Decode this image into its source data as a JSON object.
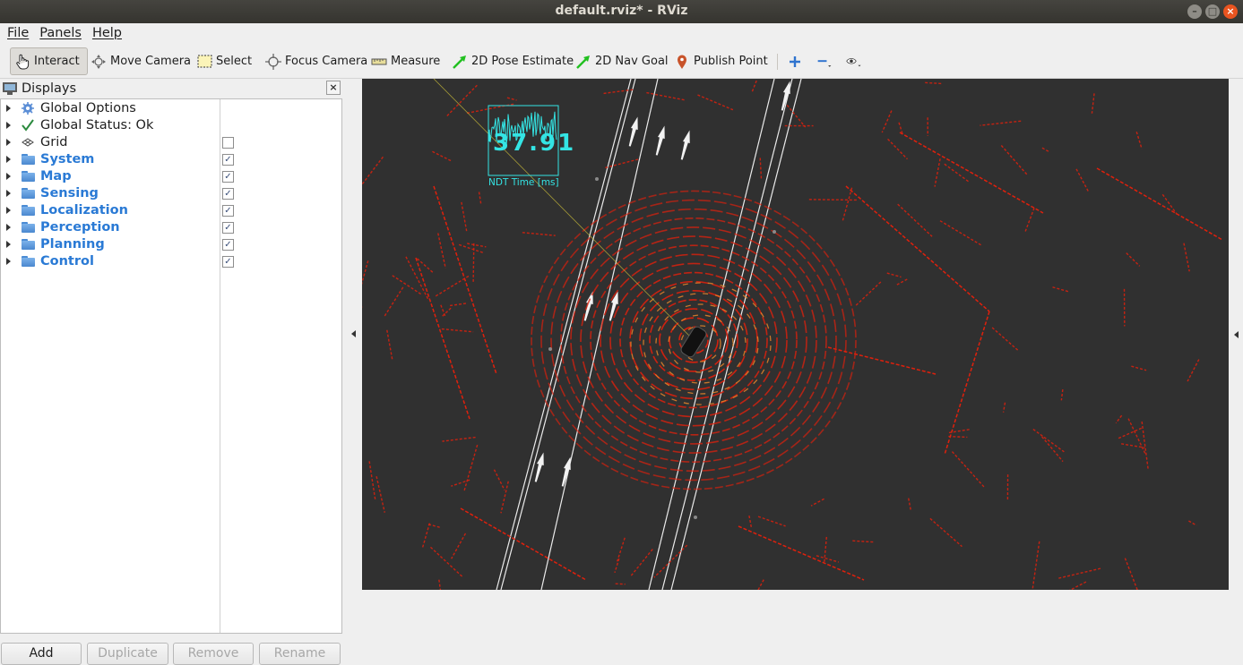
{
  "window": {
    "title": "default.rviz* - RViz"
  },
  "menu": [
    "File",
    "Panels",
    "Help"
  ],
  "toolbar": {
    "interact": "Interact",
    "move_camera": "Move Camera",
    "select": "Select",
    "focus_camera": "Focus Camera",
    "measure": "Measure",
    "pose_estimate": "2D Pose Estimate",
    "nav_goal": "2D Nav Goal",
    "publish_point": "Publish Point"
  },
  "displays": {
    "title": "Displays",
    "items": [
      {
        "label": "Global Options",
        "icon": "gear-icon",
        "group": false,
        "checkbox": null
      },
      {
        "label": "Global Status: Ok",
        "icon": "check-icon",
        "group": false,
        "checkbox": null
      },
      {
        "label": "Grid",
        "icon": "grid-icon",
        "group": false,
        "checkbox": false
      },
      {
        "label": "System",
        "icon": "folder-icon",
        "group": true,
        "checkbox": true
      },
      {
        "label": "Map",
        "icon": "folder-icon",
        "group": true,
        "checkbox": true
      },
      {
        "label": "Sensing",
        "icon": "folder-icon",
        "group": true,
        "checkbox": true
      },
      {
        "label": "Localization",
        "icon": "folder-icon",
        "group": true,
        "checkbox": true
      },
      {
        "label": "Perception",
        "icon": "folder-icon",
        "group": true,
        "checkbox": true
      },
      {
        "label": "Planning",
        "icon": "folder-icon",
        "group": true,
        "checkbox": true
      },
      {
        "label": "Control",
        "icon": "folder-icon",
        "group": true,
        "checkbox": true
      }
    ],
    "buttons": {
      "add": "Add",
      "duplicate": "Duplicate",
      "remove": "Remove",
      "rename": "Rename"
    }
  },
  "viewport": {
    "ndt_value": "37.91",
    "ndt_label": "NDT Time [ms]",
    "colors": {
      "background": "#303030",
      "points": "#e0200c",
      "ndt": "#34e4e4",
      "lanes": "#ffffff"
    }
  }
}
